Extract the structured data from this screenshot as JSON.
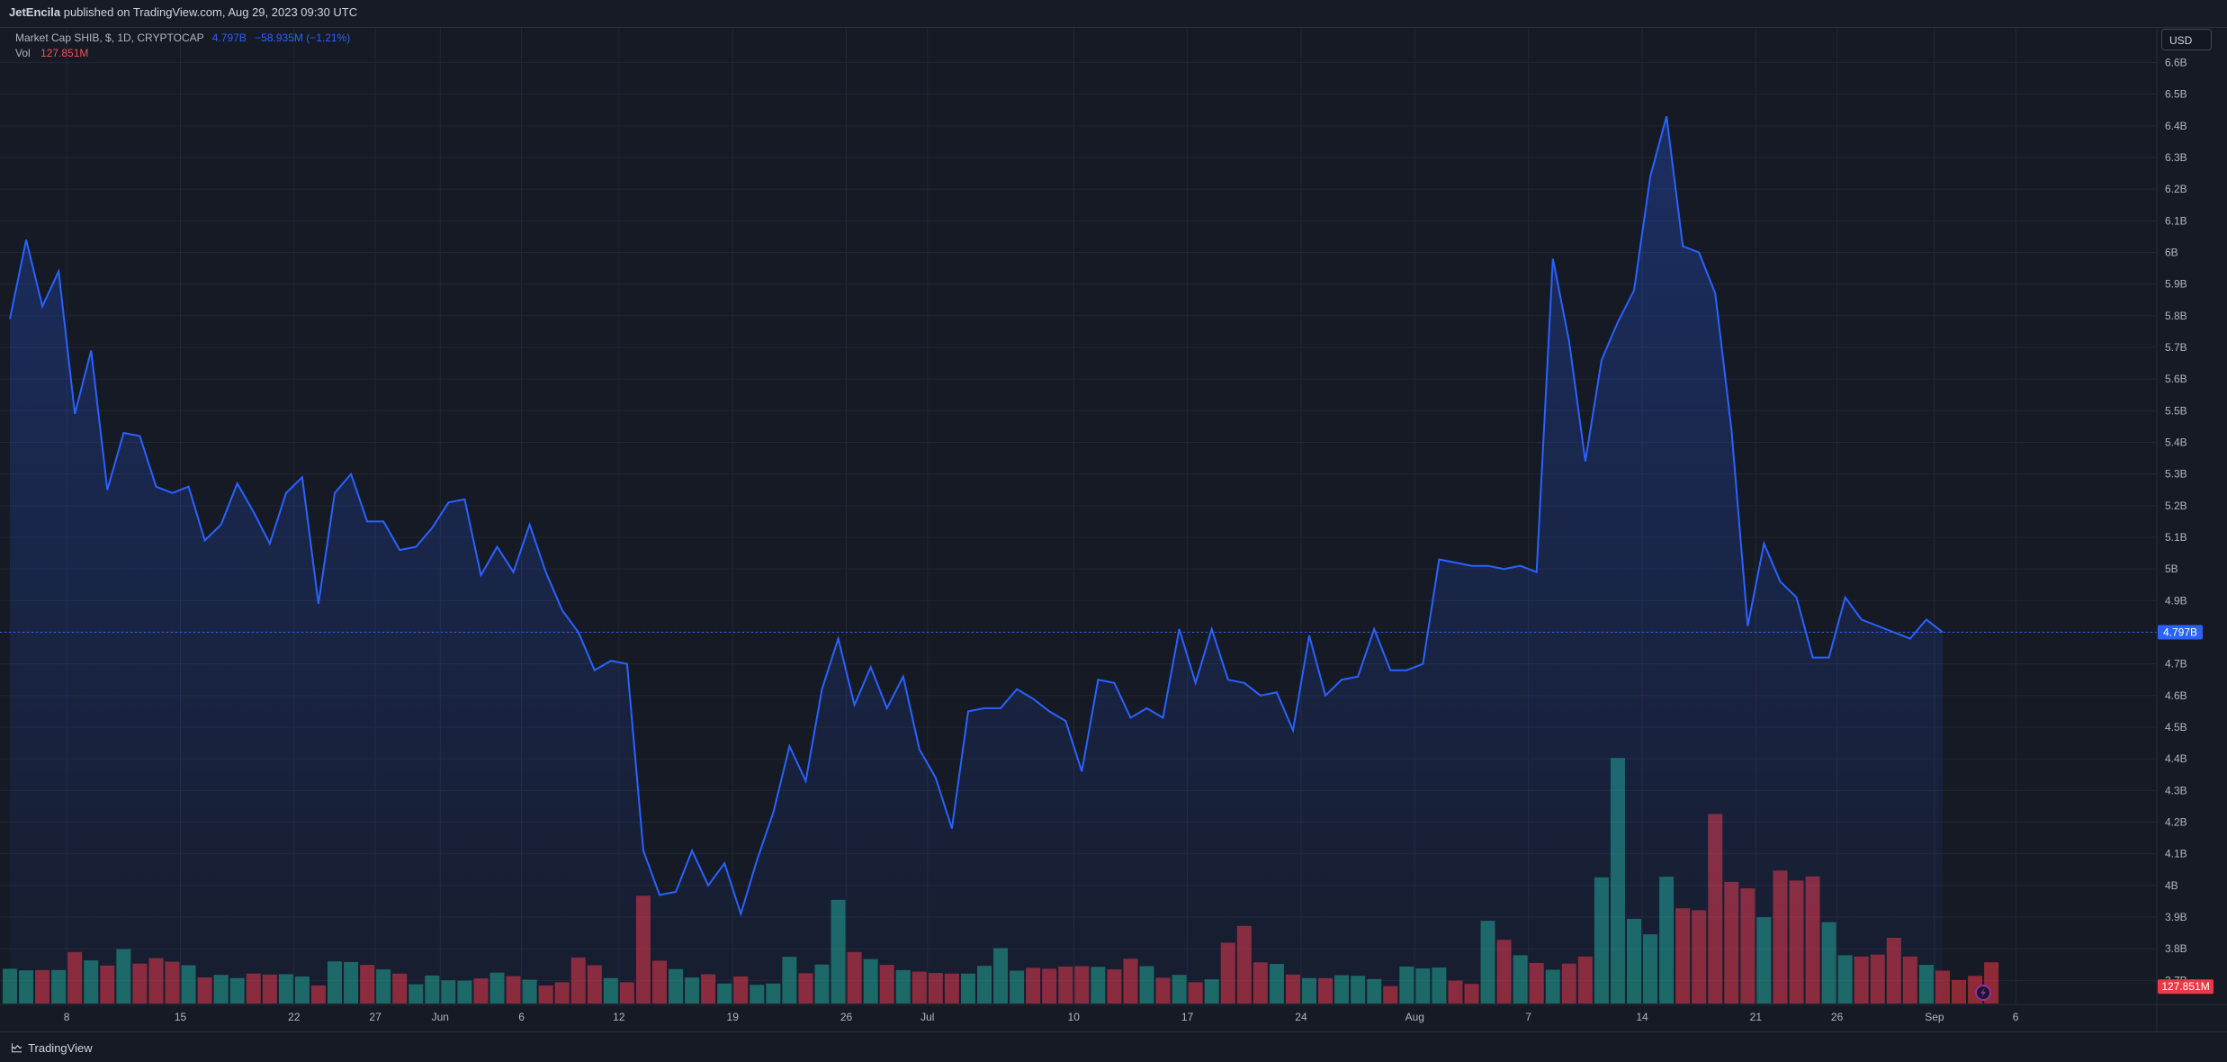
{
  "header": {
    "author": "JetEncila",
    "published_text": "published on TradingView.com, Aug 29, 2023 09:30 UTC"
  },
  "legend": {
    "symbol_text": "Market Cap SHIB, $, 1D, CRYPTOCAP",
    "last_value": "4.797B",
    "change": "−58.935M (−1.21%)",
    "vol_label": "Vol",
    "vol_value": "127.851M"
  },
  "currency_button": "USD",
  "footer": {
    "brand": "TradingView"
  },
  "colors": {
    "line": "#2962ff",
    "volume_up": "#22ab94",
    "volume_down": "#f23645",
    "grid": "#232733",
    "last_price_label_bg": "#2962ff",
    "last_volume_label_bg": "#f23645"
  },
  "chart_data": {
    "type": "line",
    "title": "Market Cap SHIB, $, 1D, CRYPTOCAP",
    "xlabel": "",
    "ylabel": "",
    "x_ticks": [
      "8",
      "15",
      "22",
      "27",
      "Jun",
      "6",
      "12",
      "19",
      "26",
      "Jul",
      "10",
      "17",
      "24",
      "Aug",
      "7",
      "14",
      "21",
      "26",
      "Sep",
      "6"
    ],
    "y_ticks": [
      "3.7B",
      "3.8B",
      "3.9B",
      "4B",
      "4.1B",
      "4.2B",
      "4.3B",
      "4.4B",
      "4.5B",
      "4.6B",
      "4.7B",
      "4.8B",
      "4.9B",
      "5B",
      "5.1B",
      "5.2B",
      "5.3B",
      "5.4B",
      "5.5B",
      "5.6B",
      "5.7B",
      "5.8B",
      "5.9B",
      "6B",
      "6.1B",
      "6.2B",
      "6.3B",
      "6.4B",
      "6.5B",
      "6.6B"
    ],
    "ylim": [
      3.68,
      6.68
    ],
    "y_unit": "B USD",
    "last_value_label": "4.797B",
    "last_volume_label": "127.851M",
    "grid": true,
    "series": [
      {
        "name": "Market Cap SHIB",
        "values": [
          5.79,
          6.04,
          5.83,
          5.94,
          5.49,
          5.69,
          5.25,
          5.43,
          5.42,
          5.26,
          5.24,
          5.26,
          5.09,
          5.14,
          5.27,
          5.18,
          5.08,
          5.24,
          5.29,
          4.89,
          5.24,
          5.3,
          5.15,
          5.15,
          5.06,
          5.07,
          5.13,
          5.21,
          5.22,
          4.98,
          5.07,
          4.99,
          5.14,
          4.99,
          4.87,
          4.8,
          4.68,
          4.71,
          4.7,
          4.11,
          3.97,
          3.98,
          4.11,
          4.0,
          4.07,
          3.91,
          4.08,
          4.23,
          4.44,
          4.33,
          4.62,
          4.78,
          4.57,
          4.69,
          4.56,
          4.66,
          4.43,
          4.34,
          4.18,
          4.55,
          4.56,
          4.56,
          4.62,
          4.59,
          4.55,
          4.52,
          4.36,
          4.65,
          4.64,
          4.53,
          4.56,
          4.53,
          4.81,
          4.64,
          4.81,
          4.65,
          4.64,
          4.6,
          4.61,
          4.49,
          4.79,
          4.6,
          4.65,
          4.66,
          4.81,
          4.68,
          4.68,
          4.7,
          5.03,
          5.02,
          5.01,
          5.01,
          5.0,
          5.01,
          4.99,
          5.98,
          5.72,
          5.34,
          5.66,
          5.78,
          5.88,
          6.24,
          6.43,
          6.02,
          6.0,
          5.87,
          5.44,
          4.82,
          5.08,
          4.96,
          4.91,
          4.72,
          4.72,
          4.91,
          4.84,
          4.82,
          4.8,
          4.78,
          4.84,
          4.8
        ]
      },
      {
        "name": "Vol",
        "unit": "M USD",
        "values": [
          108,
          103,
          104,
          104,
          160,
          134,
          118,
          169,
          124,
          141,
          130,
          119,
          81,
          89,
          79,
          93,
          90,
          91,
          84,
          56,
          131,
          129,
          120,
          106,
          93,
          60,
          87,
          72,
          71,
          78,
          96,
          85,
          74,
          56,
          66,
          143,
          119,
          79,
          66,
          335,
          133,
          107,
          81,
          91,
          62,
          84,
          58,
          62,
          145,
          94,
          121,
          322,
          160,
          138,
          120,
          104,
          99,
          95,
          93,
          93,
          117,
          172,
          102,
          111,
          108,
          115,
          116,
          114,
          106,
          139,
          116,
          80,
          89,
          66,
          75,
          189,
          241,
          128,
          123,
          90,
          79,
          79,
          88,
          86,
          76,
          54,
          115,
          109,
          112,
          71,
          61,
          257,
          198,
          150,
          126,
          105,
          124,
          146,
          392,
          763,
          263,
          215,
          394,
          296,
          290,
          589,
          378,
          358,
          268,
          413,
          382,
          395,
          253,
          150,
          146,
          152,
          204,
          146,
          120,
          102,
          73,
          86,
          128
        ]
      }
    ]
  }
}
